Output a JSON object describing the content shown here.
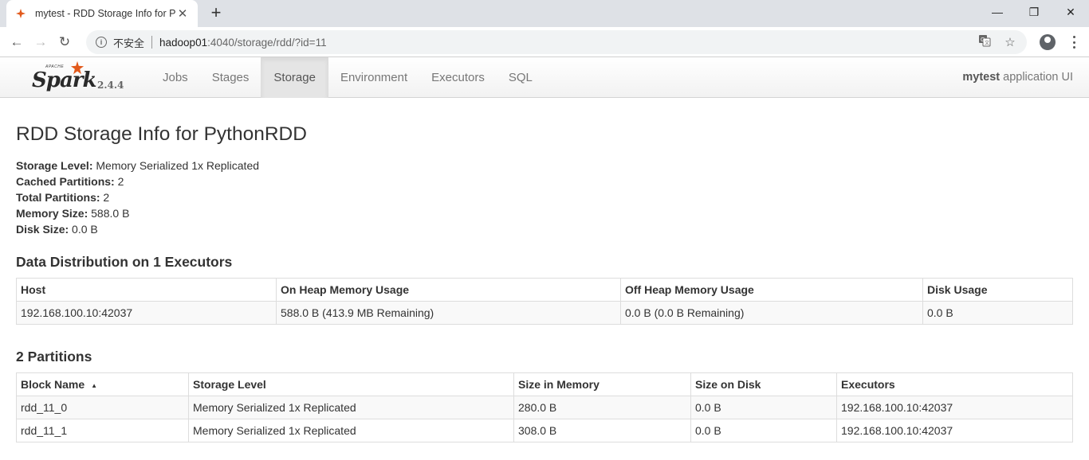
{
  "browser": {
    "tab_title": "mytest - RDD Storage Info for PythonRDD",
    "tab_close": "✕",
    "new_tab": "+",
    "window_controls": {
      "minimize": "—",
      "restore": "❐",
      "close": "✕"
    },
    "nav": {
      "back": "←",
      "forward": "→",
      "reload": "↻"
    },
    "security_label": "不安全",
    "url_host": "hadoop01",
    "url_path": ":4040/storage/rdd/?id=11",
    "icons": [
      "info-icon",
      "translate-icon",
      "star-icon",
      "account-icon",
      "menu-icon"
    ]
  },
  "spark": {
    "apache": "APACHE",
    "logo_word": "Spark",
    "version": "2.4.4",
    "tabs": [
      {
        "label": "Jobs"
      },
      {
        "label": "Stages"
      },
      {
        "label": "Storage"
      },
      {
        "label": "Environment"
      },
      {
        "label": "Executors"
      },
      {
        "label": "SQL"
      }
    ],
    "active_tab": "Storage",
    "app_name": "mytest",
    "app_suffix": " application UI"
  },
  "page": {
    "title": "RDD Storage Info for PythonRDD",
    "summary": [
      {
        "label": "Storage Level:",
        "value": " Memory Serialized 1x Replicated"
      },
      {
        "label": "Cached Partitions:",
        "value": " 2"
      },
      {
        "label": "Total Partitions:",
        "value": " 2"
      },
      {
        "label": "Memory Size:",
        "value": " 588.0 B"
      },
      {
        "label": "Disk Size:",
        "value": " 0.0 B"
      }
    ]
  },
  "distribution": {
    "heading": "Data Distribution on 1 Executors",
    "columns": [
      "Host",
      "On Heap Memory Usage",
      "Off Heap Memory Usage",
      "Disk Usage"
    ],
    "rows": [
      [
        "192.168.100.10:42037",
        "588.0 B (413.9 MB Remaining)",
        "0.0 B (0.0 B Remaining)",
        "0.0 B"
      ]
    ]
  },
  "partitions": {
    "heading": "2 Partitions",
    "columns": [
      "Block Name",
      "Storage Level",
      "Size in Memory",
      "Size on Disk",
      "Executors"
    ],
    "sort_indicator": "▲",
    "rows": [
      [
        "rdd_11_0",
        "Memory Serialized 1x Replicated",
        "280.0 B",
        "0.0 B",
        "192.168.100.10:42037"
      ],
      [
        "rdd_11_1",
        "Memory Serialized 1x Replicated",
        "308.0 B",
        "0.0 B",
        "192.168.100.10:42037"
      ]
    ]
  }
}
